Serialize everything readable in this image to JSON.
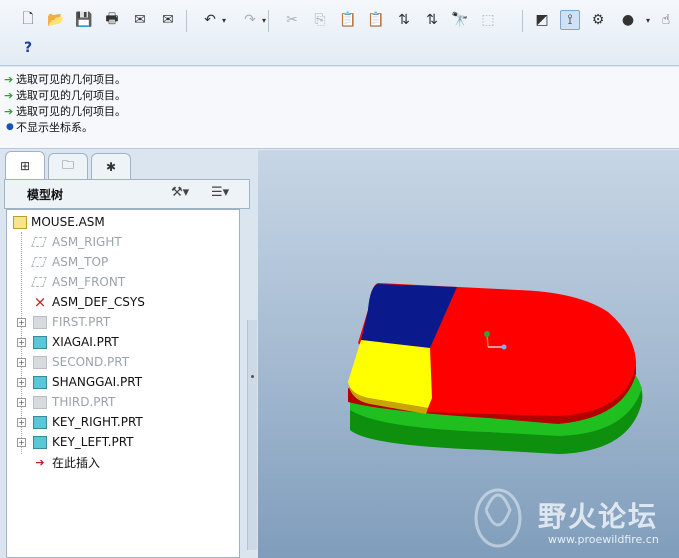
{
  "toolbar": {
    "row1": [
      {
        "name": "new-file-icon",
        "glyph": "🗋"
      },
      {
        "name": "open-folder-icon",
        "glyph": "📂"
      },
      {
        "name": "save-icon",
        "glyph": "💾"
      },
      {
        "name": "print-icon",
        "glyph": "🖶"
      },
      {
        "name": "mail-icon",
        "glyph": "✉"
      },
      {
        "name": "mail-attach-icon",
        "glyph": "✉"
      },
      {
        "name": "undo-icon",
        "glyph": "↶"
      },
      {
        "name": "redo-icon",
        "glyph": "↷"
      },
      {
        "name": "cut-icon",
        "glyph": "✂"
      },
      {
        "name": "copy-icon",
        "glyph": "⎘"
      },
      {
        "name": "paste-icon",
        "glyph": "📋"
      },
      {
        "name": "paste-special-icon",
        "glyph": "📋"
      },
      {
        "name": "regenerate-icon",
        "glyph": "⇅"
      },
      {
        "name": "regen-manager-icon",
        "glyph": "⇅"
      },
      {
        "name": "find-icon",
        "glyph": "🔭"
      },
      {
        "name": "select-box-icon",
        "glyph": "⬚"
      },
      {
        "name": "datum-display-icon",
        "glyph": "◩"
      },
      {
        "name": "csys-display-icon",
        "glyph": "⟟"
      },
      {
        "name": "spin-center-icon",
        "glyph": "⚙"
      },
      {
        "name": "shading-icon",
        "glyph": "●"
      },
      {
        "name": "hand-cursor-icon",
        "glyph": "☝"
      }
    ],
    "row2": [
      {
        "name": "context-help-icon",
        "glyph": "?"
      }
    ]
  },
  "messages": [
    {
      "type": "arrow",
      "text": "选取可见的几何项目。"
    },
    {
      "type": "arrow",
      "text": "选取可见的几何项目。"
    },
    {
      "type": "arrow",
      "text": "选取可见的几何项目。"
    },
    {
      "type": "dot",
      "text": "不显示坐标系。"
    }
  ],
  "panel": {
    "tabs": [
      {
        "name": "tab-model-tree",
        "icon": "⊞"
      },
      {
        "name": "tab-folder-browser",
        "icon": "🗀"
      },
      {
        "name": "tab-favorites",
        "icon": "✱"
      }
    ],
    "tree_title": "模型树",
    "settings_icon": "tools-icon",
    "show_icon": "list-settings-icon"
  },
  "tree": {
    "items": [
      {
        "label": "MOUSE.ASM",
        "kind": "asm",
        "expander": false,
        "dim": false,
        "indent": 0
      },
      {
        "label": "ASM_RIGHT",
        "kind": "plane",
        "expander": false,
        "dim": true,
        "indent": 1
      },
      {
        "label": "ASM_TOP",
        "kind": "plane",
        "expander": false,
        "dim": true,
        "indent": 1
      },
      {
        "label": "ASM_FRONT",
        "kind": "plane",
        "expander": false,
        "dim": true,
        "indent": 1
      },
      {
        "label": "ASM_DEF_CSYS",
        "kind": "csys",
        "expander": false,
        "dim": false,
        "indent": 1
      },
      {
        "label": "FIRST.PRT",
        "kind": "part",
        "expander": true,
        "dim": true,
        "indent": 1
      },
      {
        "label": "XIAGAI.PRT",
        "kind": "part",
        "expander": true,
        "dim": false,
        "indent": 1
      },
      {
        "label": "SECOND.PRT",
        "kind": "part",
        "expander": true,
        "dim": true,
        "indent": 1
      },
      {
        "label": "SHANGGAI.PRT",
        "kind": "part",
        "expander": true,
        "dim": false,
        "indent": 1
      },
      {
        "label": "THIRD.PRT",
        "kind": "part",
        "expander": true,
        "dim": true,
        "indent": 1
      },
      {
        "label": "KEY_RIGHT.PRT",
        "kind": "part",
        "expander": true,
        "dim": false,
        "indent": 1
      },
      {
        "label": "KEY_LEFT.PRT",
        "kind": "part",
        "expander": true,
        "dim": false,
        "indent": 1
      },
      {
        "label": "在此插入",
        "kind": "insert",
        "expander": false,
        "dim": false,
        "indent": 1
      }
    ]
  },
  "graphics": {
    "model_colors": {
      "base": "#1fbf1f",
      "base_dark": "#0e8f0e",
      "top": "#ff0000",
      "top_dark": "#b50000",
      "key_left_back": "#0a1a8c",
      "key_left_front": "#ffff00",
      "key_right": "#ff0000"
    }
  },
  "watermark": {
    "text": "野火论坛",
    "url": "www.proewildfire.cn"
  }
}
